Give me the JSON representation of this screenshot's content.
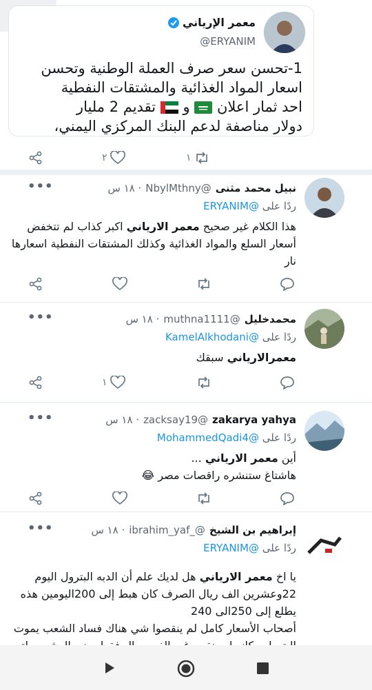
{
  "original_tweet": {
    "author_name": "معمر الإرياني",
    "handle": "@ERYANIM",
    "text_line1": "1-تحسن سعر صرف العملة الوطنية وتحسن",
    "text_line2": "اسعار المواد الغذائية والمشتقات النفطية",
    "text_line3_a": "احد ثمار اعلان",
    "text_line3_b": "و",
    "text_line3_c": "تقديم 2 مليار",
    "text_line4": "دولار مناصفة لدعم البنك المركزي اليمني،",
    "retweets": "١",
    "likes": "٢"
  },
  "replies": [
    {
      "name": "نبيل محمد مثنى",
      "handle": "@NbylMthny",
      "time": "· ١٨ س",
      "replying_label": "ردًا على",
      "replying_to": "@ERYANIM",
      "body_line1_bold": "معمر الارياني",
      "body_line1_pre": "هذا الكلام غير صحيح",
      "body_line1_post": "اكبر كذاب لم تتخفض",
      "body_line2": "أسعار السلع والمواد الغذائية وكذلك المشتقات النفطية اسعارها",
      "body_line3": "نار",
      "likes": "",
      "retweets": ""
    },
    {
      "name": "محمدخليل",
      "handle": "@muthna1111",
      "time": "· ١٨ س",
      "replying_label": "ردًا على",
      "replying_to": "@KamelAlkhodani",
      "body_line1_bold": "معمرالارياني",
      "body_line1_post": "سبقك",
      "likes": "١",
      "retweets": ""
    },
    {
      "name": "zakarya yahya",
      "handle": "@zacksay19",
      "time": "· ١٨ س",
      "replying_label": "ردًا على",
      "replying_to": "@MohammedQadi4",
      "body_line1_pre": "أين",
      "body_line1_bold": "معمر الارياني",
      "body_line1_post": "...",
      "body_line2": "هاشتاغ ستنشره راقصات مصر",
      "emoji": "😂",
      "likes": "",
      "retweets": ""
    },
    {
      "name": "إبراهيم بن الشيخ",
      "handle": "@_ibrahim_yaf",
      "time": "· ١٨ س",
      "replying_label": "ردًا على",
      "replying_to": "@ERYANIM",
      "body_line1_pre": "يا اخ",
      "body_line1_bold": "معمر الارياني",
      "body_line1_post": "هل لديك علم أن الدبه البترول اليوم",
      "body_line2": "22وعشرين الف ريال الصرف كان هبط إلى 200اليومين هذه",
      "body_line3": "يطلع إلى 250الى 240",
      "body_line4": "أصحاب الأسعار كامل لم ينقصوا شي هناك فساد الشعب يموت",
      "body_line5": "البترول مكانه لم ينقص غير الفين ريال فقط يعني العشرين لتر"
    }
  ],
  "colors": {
    "accent": "#1b95e0",
    "muted": "#657786",
    "verified": "#1d9bf0"
  }
}
